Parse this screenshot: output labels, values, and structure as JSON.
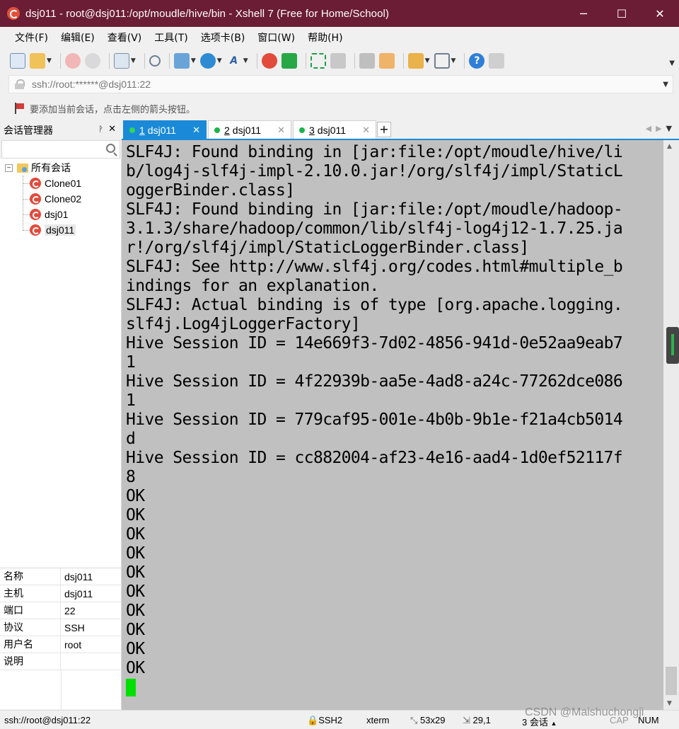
{
  "window": {
    "title": "dsj011 - root@dsj011:/opt/moudle/hive/bin - Xshell 7 (Free for Home/School)",
    "minimize": "─",
    "maximize": "☐",
    "close": "✕"
  },
  "menu": [
    "文件(F)",
    "编辑(E)",
    "查看(V)",
    "工具(T)",
    "选项卡(B)",
    "窗口(W)",
    "帮助(H)"
  ],
  "address": {
    "value": "ssh://root:******@dsj011:22"
  },
  "hint": "要添加当前会话，点击左侧的箭头按钮。",
  "session_manager": {
    "title": "会话管理器",
    "pin": "ᚹ",
    "close": "✕",
    "search_placeholder": "",
    "root_label": "所有会话",
    "sessions": [
      "Clone01",
      "Clone02",
      "dsj01",
      "dsj011"
    ],
    "selected": "dsj011"
  },
  "properties": [
    {
      "key": "名称",
      "value": "dsj011"
    },
    {
      "key": "主机",
      "value": "dsj011"
    },
    {
      "key": "端口",
      "value": "22"
    },
    {
      "key": "协议",
      "value": "SSH"
    },
    {
      "key": "用户名",
      "value": "root"
    },
    {
      "key": "说明",
      "value": ""
    }
  ],
  "tabs": [
    {
      "num": "1",
      "label": "dsj011",
      "active": true
    },
    {
      "num": "2",
      "label": "dsj011",
      "active": false
    },
    {
      "num": "3",
      "label": "dsj011",
      "active": false
    }
  ],
  "tab_add": "+",
  "terminal": {
    "lines": [
      "SLF4J: Found binding in [jar:file:/opt/moudle/hive/li",
      "b/log4j-slf4j-impl-2.10.0.jar!/org/slf4j/impl/StaticL",
      "oggerBinder.class]",
      "SLF4J: Found binding in [jar:file:/opt/moudle/hadoop-",
      "3.1.3/share/hadoop/common/lib/slf4j-log4j12-1.7.25.ja",
      "r!/org/slf4j/impl/StaticLoggerBinder.class]",
      "SLF4J: See http://www.slf4j.org/codes.html#multiple_b",
      "indings for an explanation.",
      "SLF4J: Actual binding is of type [org.apache.logging.",
      "slf4j.Log4jLoggerFactory]",
      "Hive Session ID = 14e669f3-7d02-4856-941d-0e52aa9eab7",
      "1",
      "Hive Session ID = 4f22939b-aa5e-4ad8-a24c-77262dce086",
      "1",
      "Hive Session ID = 779caf95-001e-4b0b-9b1e-f21a4cb5014",
      "d",
      "Hive Session ID = cc882004-af23-4e16-aad4-1d0ef52117f",
      "8",
      "OK",
      "OK",
      "OK",
      "OK",
      "OK",
      "OK",
      "OK",
      "OK",
      "OK",
      "OK"
    ]
  },
  "statusbar": {
    "connection": "ssh://root@dsj011:22",
    "protocol": "SSH2",
    "term": "xterm",
    "size": "53x29",
    "position": "29,1",
    "sessions": "3 会话",
    "caps": "CAP",
    "num": "NUM"
  },
  "watermark": "CSDN @Maishuchongji",
  "colors": {
    "titlebar": "#6b1d35",
    "tab_active": "#1a8ad8",
    "terminal_bg": "#c0c0c0",
    "cursor": "#00e000"
  }
}
